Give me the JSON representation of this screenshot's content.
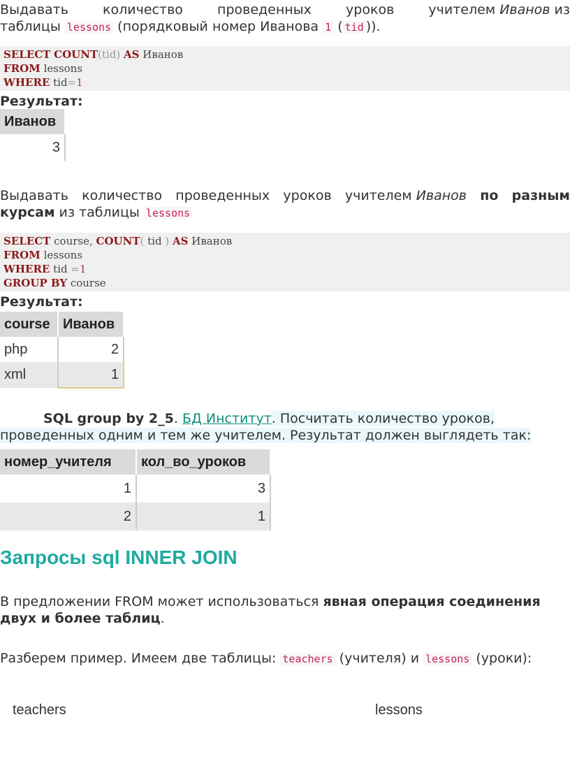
{
  "p1": {
    "line1": {
      "w1": "Выдавать",
      "w2": "количество",
      "w3": "проведенных",
      "w4": "уроков",
      "w5": "учителем",
      "name": "Иванов",
      "tail": "из"
    },
    "line2_prefix": "таблицы",
    "code_table": "lessons",
    "middle": "(порядковый номер Иванова",
    "code_num": "1",
    "paren_open": "(",
    "code_tid": "tid",
    "suffix": "))."
  },
  "q1": {
    "l1": {
      "select": "SELECT",
      "count": "COUNT",
      "args": "(tid)",
      "as": "AS",
      "alias": "Иванов"
    },
    "l2": {
      "from": "FROM",
      "table": "lessons"
    },
    "l3": {
      "where": "WHERE",
      "col": "tid",
      "op": "=",
      "val": "1"
    }
  },
  "res1": {
    "label": "Результат:",
    "header": "Иванов",
    "value": "3"
  },
  "p2": {
    "line1": {
      "w1": "Выдавать",
      "w2": "количество",
      "w3": "проведенных",
      "w4": "уроков",
      "w5": "учителем",
      "name": "Иванов",
      "bold1": "по",
      "bold2": "разным"
    },
    "line2": {
      "bold": "курсам",
      "rest": "из таблицы",
      "code": "lessons"
    }
  },
  "q2": {
    "l1": {
      "select": "SELECT",
      "col": "course,",
      "count": "COUNT",
      "lp": "(",
      "arg": "tid",
      "rp": ")",
      "as": "AS",
      "alias": "Иванов"
    },
    "l2": {
      "from": "FROM",
      "table": "lessons"
    },
    "l3": {
      "where": "WHERE",
      "col": "tid",
      "op": "=",
      "val": "1"
    },
    "l4": {
      "group": "GROUP BY",
      "col": "course"
    }
  },
  "res2": {
    "label": "Результат:",
    "headers": [
      "course",
      "Иванов"
    ],
    "rows": [
      [
        "php",
        "2"
      ],
      [
        "xml",
        "1"
      ]
    ]
  },
  "task": {
    "title": "SQL group by 2_5",
    "dot": ".",
    "link": "БД Институт",
    "text1": ". Посчитать количество уроков,",
    "line2": "проведенных одним и тем же учителем. Результат должен выглядеть так:"
  },
  "res3": {
    "headers": [
      "номер_учителя",
      "кол_во_уроков"
    ],
    "rows": [
      [
        "1",
        "3"
      ],
      [
        "2",
        "1"
      ]
    ]
  },
  "heading": "Запросы sql INNER JOIN",
  "p3": {
    "text": "В предложении FROM может использоваться ",
    "bold": "явная операция соединения двух и более таблиц",
    "tail": "."
  },
  "p4": {
    "text": "Разберем пример. Имеем две таблицы: ",
    "code1": "teachers",
    "mid": " (учителя) и ",
    "code2": "lessons",
    "tail": " (уроки):"
  },
  "labels": {
    "teachers": "teachers",
    "lessons": "lessons"
  },
  "colors": {
    "keyword": "#8b1a1a",
    "heading": "#1eaaa0",
    "link": "#0d8d7d",
    "code": "#c7254e",
    "highlight": "#eaf8fb"
  }
}
